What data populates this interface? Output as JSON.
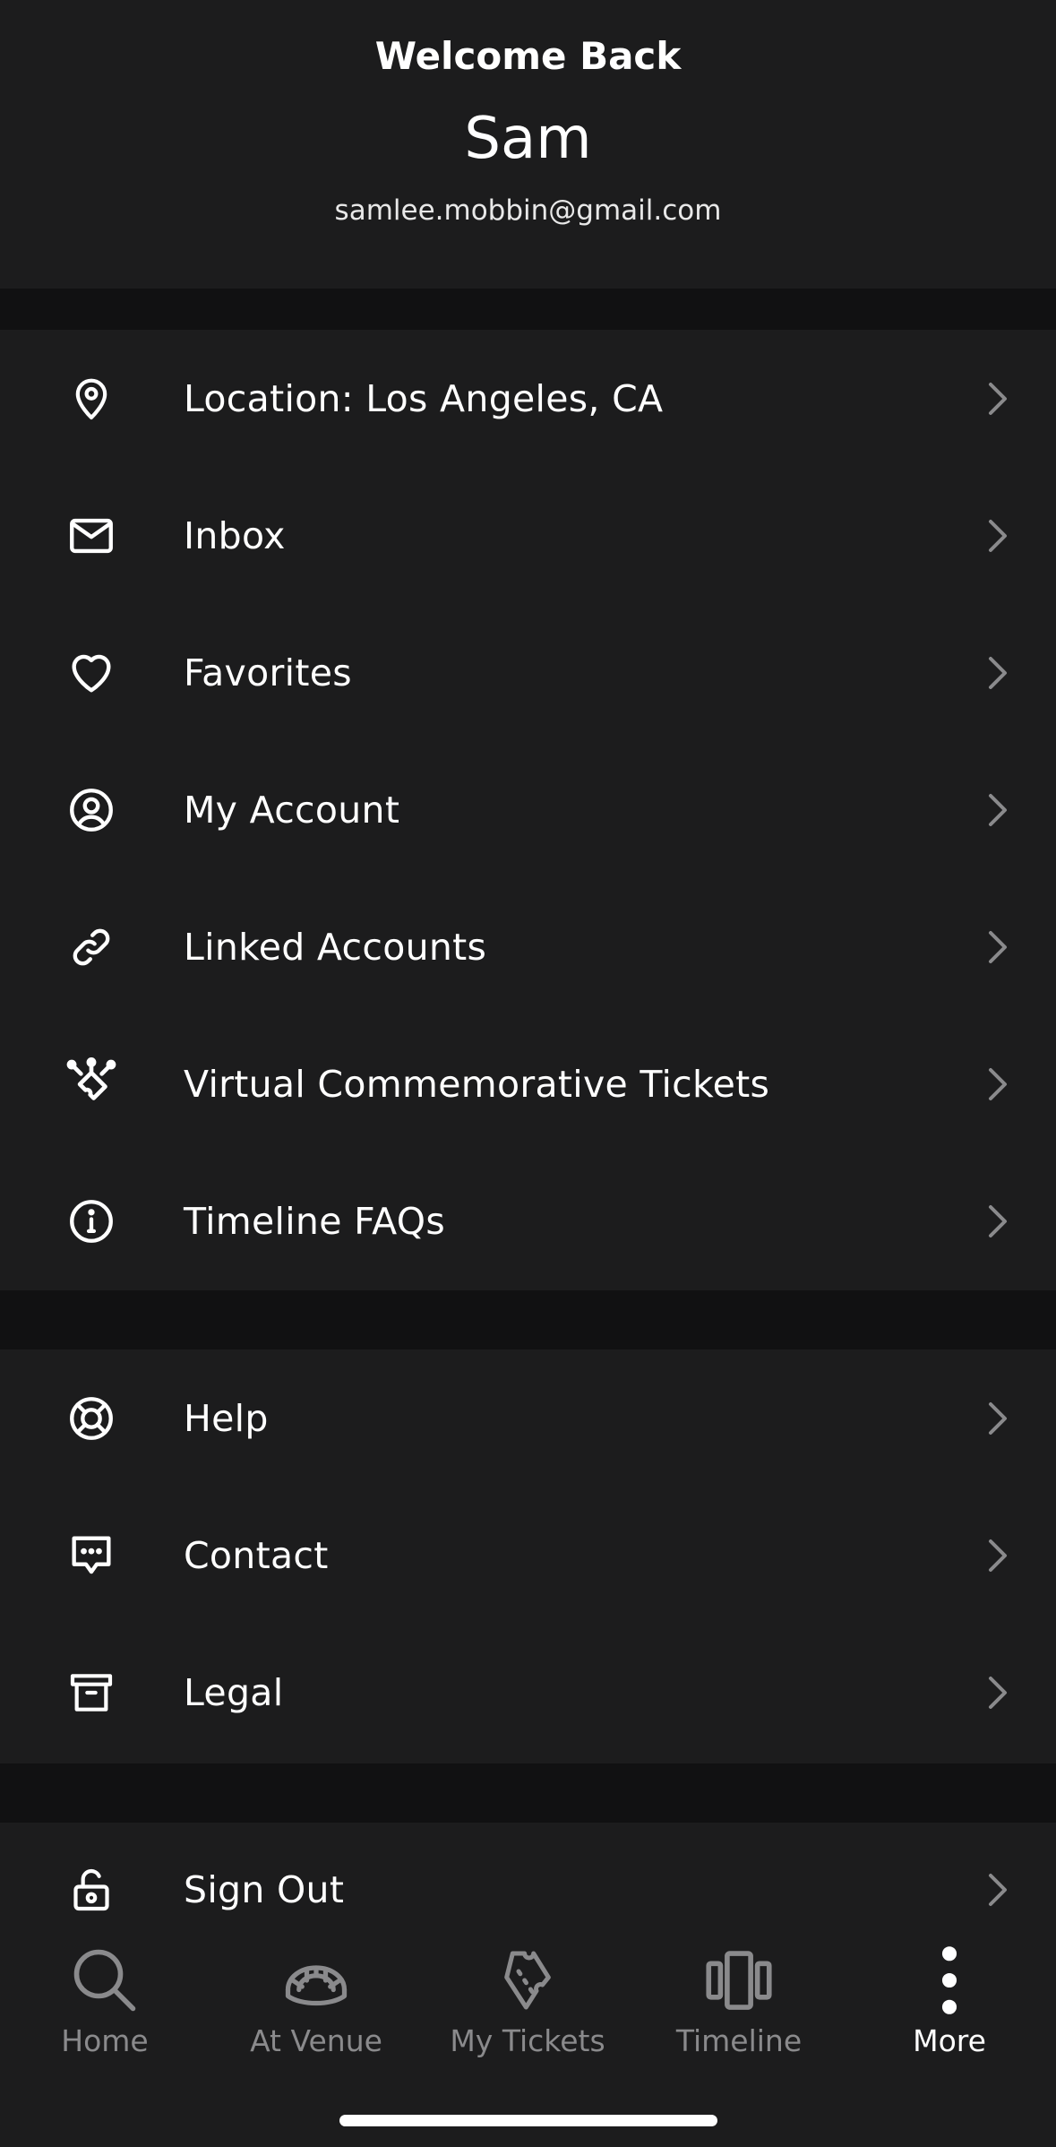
{
  "header": {
    "welcome": "Welcome Back",
    "name": "Sam",
    "email": "samlee.mobbin@gmail.com"
  },
  "menu_primary": [
    {
      "label": "Location: Los Angeles, CA",
      "icon": "location-pin-icon"
    },
    {
      "label": "Inbox",
      "icon": "envelope-icon"
    },
    {
      "label": "Favorites",
      "icon": "heart-icon"
    },
    {
      "label": "My Account",
      "icon": "user-circle-icon"
    },
    {
      "label": "Linked Accounts",
      "icon": "link-icon"
    },
    {
      "label": "Virtual Commemorative Tickets",
      "icon": "sparkle-ticket-icon"
    },
    {
      "label": "Timeline FAQs",
      "icon": "info-icon"
    }
  ],
  "menu_support": [
    {
      "label": "Help",
      "icon": "lifebuoy-icon"
    },
    {
      "label": "Contact",
      "icon": "chat-bubble-icon"
    },
    {
      "label": "Legal",
      "icon": "archive-box-icon"
    }
  ],
  "menu_account": [
    {
      "label": "Sign Out",
      "icon": "unlock-icon"
    }
  ],
  "tabbar": [
    {
      "label": "Home",
      "icon": "search-icon",
      "active": false
    },
    {
      "label": "At Venue",
      "icon": "stadium-icon",
      "active": false
    },
    {
      "label": "My Tickets",
      "icon": "ticket-icon",
      "active": false
    },
    {
      "label": "Timeline",
      "icon": "carousel-icon",
      "active": false
    },
    {
      "label": "More",
      "icon": "more-vertical-icon",
      "active": true
    }
  ],
  "colors": {
    "background": "#1c1c1d",
    "separator": "#111112",
    "text": "#ffffff",
    "inactive_tab": "#8a8a8c"
  }
}
